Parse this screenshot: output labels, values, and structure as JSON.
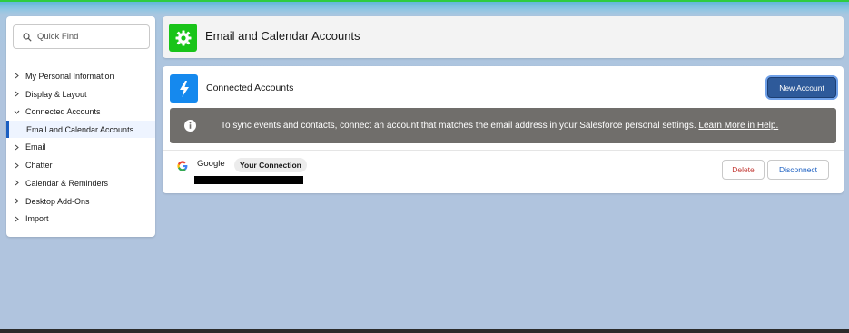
{
  "colors": {
    "accent_green": "#19c419",
    "accent_blue": "#1589ee",
    "primary_button": "#2e5a9a",
    "banner_gray": "#706e6b",
    "delete_red": "#c23934",
    "link_blue": "#1b5fc1",
    "page_background": "#b0c4de"
  },
  "sidebar": {
    "search": {
      "placeholder": "Quick Find",
      "icon": "search-icon"
    },
    "items": [
      {
        "label": "My Personal Information",
        "expanded": false
      },
      {
        "label": "Display & Layout",
        "expanded": false
      },
      {
        "label": "Connected Accounts",
        "expanded": true
      },
      {
        "label": "Email",
        "expanded": false
      },
      {
        "label": "Chatter",
        "expanded": false
      },
      {
        "label": "Calendar & Reminders",
        "expanded": false
      },
      {
        "label": "Desktop Add-Ons",
        "expanded": false
      },
      {
        "label": "Import",
        "expanded": false
      }
    ],
    "subitem": {
      "label": "Email and Calendar Accounts",
      "selected": true
    }
  },
  "header": {
    "title": "Email and Calendar Accounts",
    "icon": "gear-icon"
  },
  "connected": {
    "title": "Connected Accounts",
    "icon": "lightning-icon",
    "new_account_label": "New Account",
    "banner": {
      "text": "To sync events and contacts, connect an account that matches the email address in your Salesforce personal settings. ",
      "link": "Learn More in Help."
    },
    "account": {
      "provider": "Google",
      "badge": "Your Connection",
      "delete_label": "Delete",
      "disconnect_label": "Disconnect"
    }
  }
}
